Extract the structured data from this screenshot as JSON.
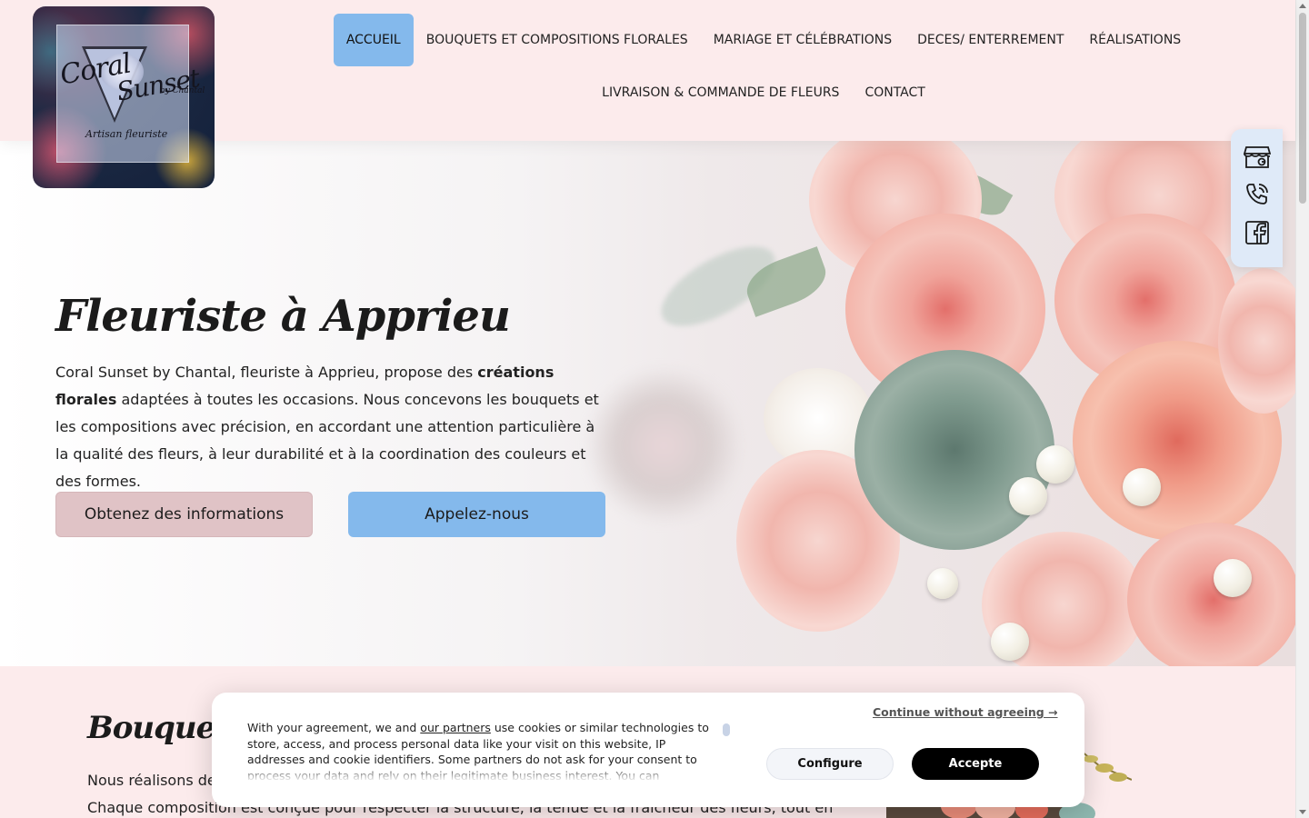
{
  "brand": {
    "logo_line1": "Coral",
    "logo_line2": "Sunset",
    "logo_by": "by Chantal",
    "logo_tagline": "Artisan fleuriste"
  },
  "nav": {
    "row1": [
      "ACCUEIL",
      "BOUQUETS ET COMPOSITIONS FLORALES",
      "MARIAGE ET CÉLÉBRATIONS",
      "DECES/ ENTERREMENT",
      "RÉALISATIONS"
    ],
    "row2": [
      "LIVRAISON & COMMANDE DE FLEURS",
      "CONTACT"
    ],
    "active": "ACCUEIL"
  },
  "social": {
    "icons": [
      "google-business-icon",
      "phone-icon",
      "facebook-icon"
    ]
  },
  "hero": {
    "title": "Fleuriste à Apprieu",
    "text_before": "Coral Sunset by Chantal, fleuriste à Apprieu, propose des ",
    "text_bold": "créations florales",
    "text_after": " adaptées à toutes les occasions. Nous concevons les bouquets et les compositions avec précision, en accordant une attention particulière à la qualité des fleurs, à leur durabilité et à la coordination des couleurs et des formes.",
    "btn_info": "Obtenez des informations",
    "btn_call": "Appelez-nous"
  },
  "section2": {
    "title": "Bouquets e",
    "line1": "Nous réalisons des",
    "line2": "Chaque composition est conçue pour respecter la structure, la tenue et la fraîcheur des fleurs, tout en"
  },
  "cookie": {
    "text_1": "With your agreement, we and ",
    "partners_link": "our partners",
    "text_2": " use cookies or similar technologies to store, access, and process personal data like your visit on this website, IP addresses and cookie identifiers. Some partners do not ask for your consent to process your data and rely on their legitimate business interest. You can",
    "continue": "Continue without agreeing →",
    "configure": "Configure",
    "accept": "Accepte"
  },
  "colors": {
    "header_bg": "#fcebec",
    "accent_blue": "#84b9ec",
    "accent_pink": "#e0c3c6"
  }
}
